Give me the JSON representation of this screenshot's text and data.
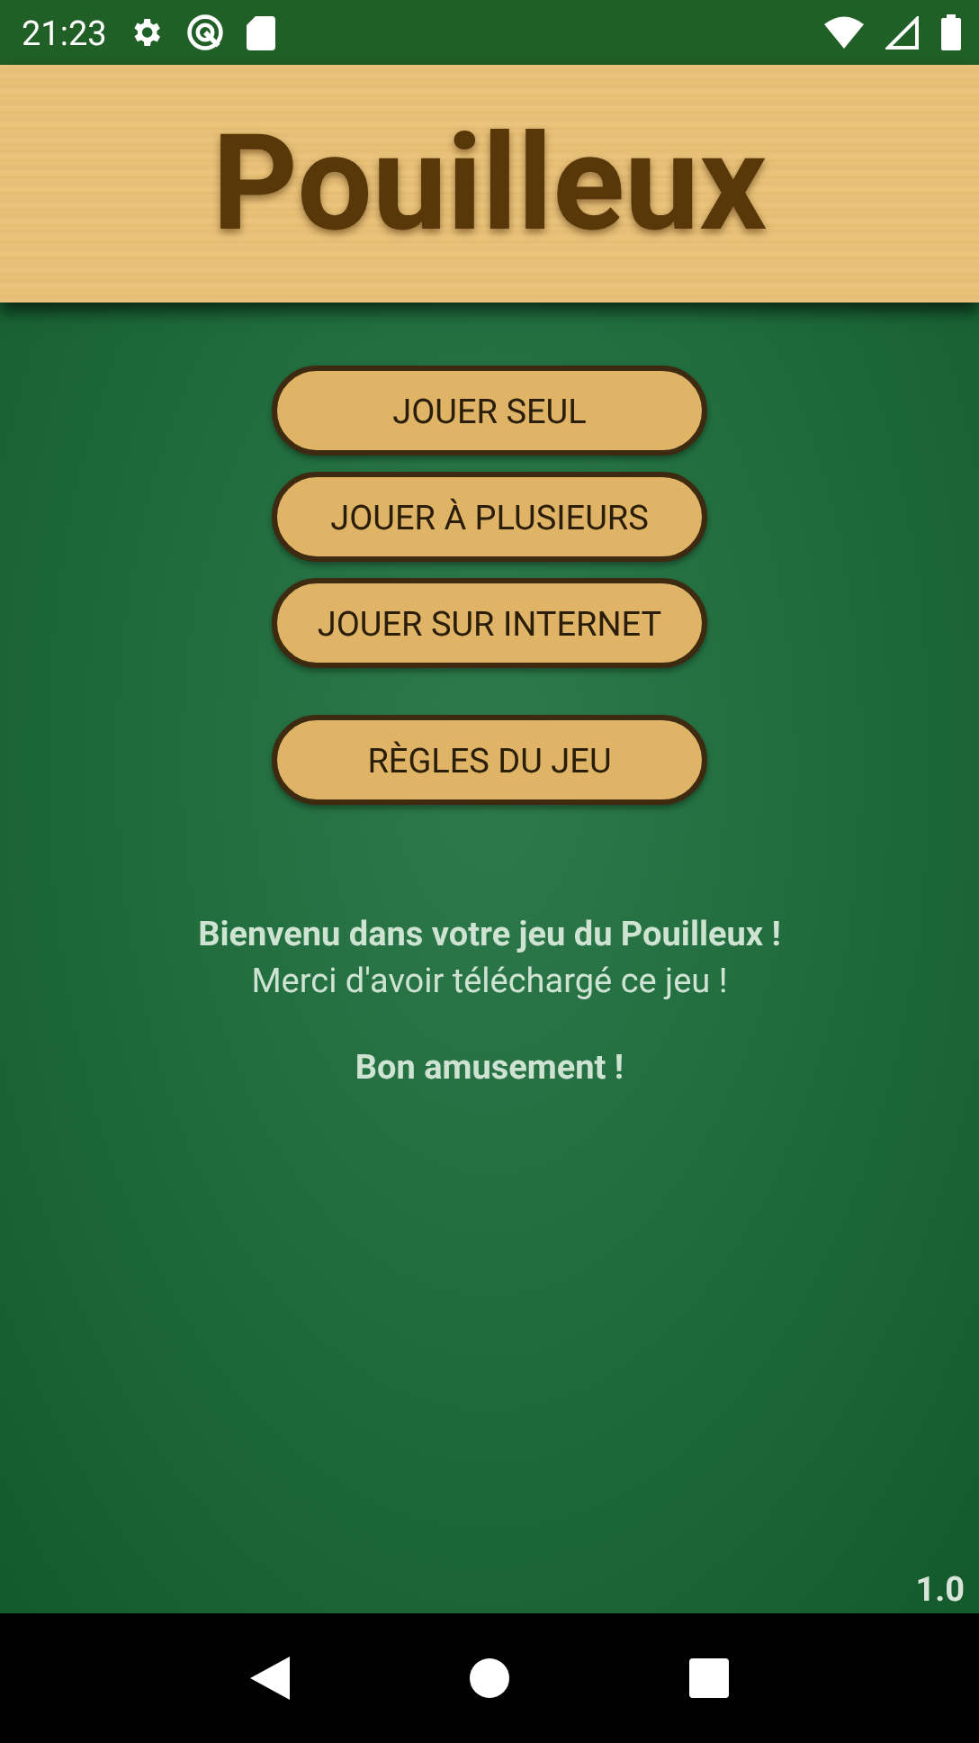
{
  "status_bar": {
    "time": "21:23"
  },
  "header": {
    "title": "Pouilleux"
  },
  "game_modes": [
    "JOUER SEUL",
    "JOUER À PLUSIEURS",
    "JOUER SUR INTERNET"
  ],
  "rules_button": "RÈGLES DU JEU",
  "message": [
    {
      "text": "Bienvenu dans votre jeu du Pouilleux !",
      "kind": "strong"
    },
    {
      "text": "Merci d'avoir téléchargé ce jeu !",
      "kind": "plain"
    },
    {
      "text": "Bon amusement !",
      "kind": "strong"
    }
  ],
  "version": "1.0"
}
